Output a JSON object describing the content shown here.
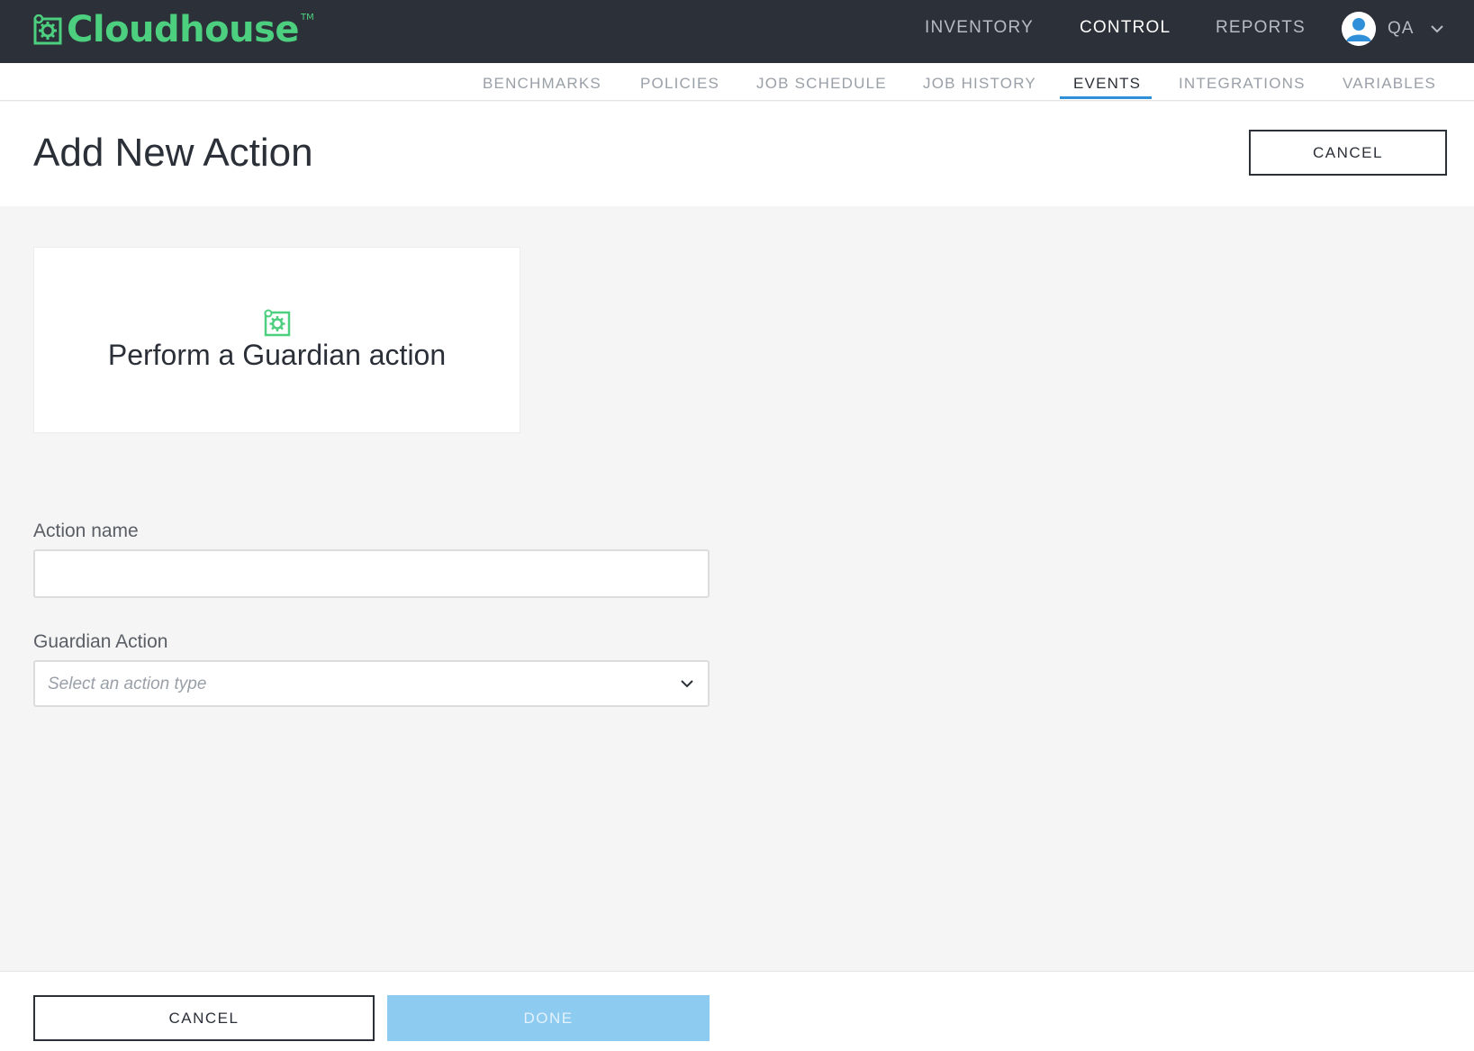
{
  "app": {
    "logo_text": "Cloudhouse",
    "logo_tm": "TM",
    "brand_color": "#4ccf7e"
  },
  "topnav": {
    "items": [
      {
        "label": "INVENTORY",
        "active": false
      },
      {
        "label": "CONTROL",
        "active": true
      },
      {
        "label": "REPORTS",
        "active": false
      }
    ],
    "user": {
      "name": "QA",
      "avatar_icon": "user-avatar-icon",
      "menu_icon": "chevron-down-icon"
    }
  },
  "subnav": {
    "items": [
      {
        "label": "BENCHMARKS",
        "active": false
      },
      {
        "label": "POLICIES",
        "active": false
      },
      {
        "label": "JOB SCHEDULE",
        "active": false
      },
      {
        "label": "JOB HISTORY",
        "active": false
      },
      {
        "label": "EVENTS",
        "active": true
      },
      {
        "label": "INTEGRATIONS",
        "active": false
      },
      {
        "label": "VARIABLES",
        "active": false
      }
    ],
    "active_color": "#2f8fd8"
  },
  "page": {
    "title": "Add New Action",
    "cancel_label": "CANCEL"
  },
  "action_card": {
    "icon": "guardian-gear-icon",
    "title": "Perform a Guardian action"
  },
  "form": {
    "action_name": {
      "label": "Action name",
      "value": "",
      "placeholder": ""
    },
    "guardian_action": {
      "label": "Guardian Action",
      "placeholder": "Select an action type",
      "icon": "chevron-down-icon"
    }
  },
  "footer": {
    "cancel_label": "CANCEL",
    "done_label": "DONE",
    "done_color": "#8ecbf0"
  }
}
